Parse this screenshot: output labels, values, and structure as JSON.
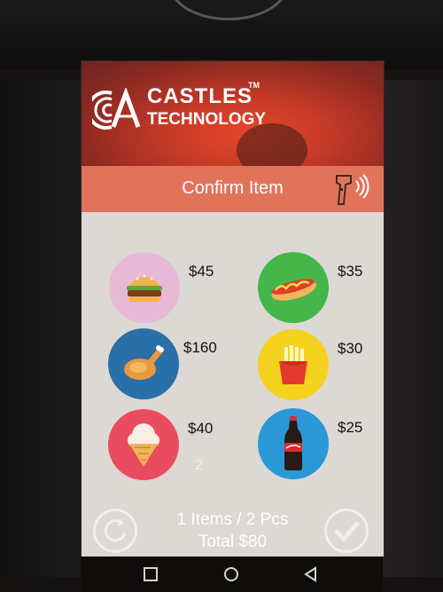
{
  "brand": {
    "name": "CASTLES",
    "tm": "TM",
    "subtitle": "TECHNOLOGY"
  },
  "title_bar": {
    "title": "Confirm Item",
    "icon": "barcode-scanner-icon"
  },
  "items": [
    {
      "name_icon": "burger-icon",
      "price": "$45",
      "qty": "",
      "color": "#e8b9d7"
    },
    {
      "name_icon": "hotdog-icon",
      "price": "$35",
      "qty": "",
      "color": "#45b649"
    },
    {
      "name_icon": "roast-chicken-icon",
      "price": "$160",
      "qty": "",
      "color": "#2a6fa8"
    },
    {
      "name_icon": "french-fries-icon",
      "price": "$30",
      "qty": "",
      "color": "#f5d21e"
    },
    {
      "name_icon": "ice-cream-icon",
      "price": "$40",
      "qty": "2",
      "color": "#e94c5f"
    },
    {
      "name_icon": "cola-bottle-icon",
      "price": "$25",
      "qty": "",
      "color": "#2a98d6"
    }
  ],
  "summary": {
    "line1": "1 Items / 2 Pcs",
    "line2": "Total $80"
  },
  "buttons": {
    "reset": "refresh-icon",
    "confirm": "checkmark-icon"
  },
  "nav": [
    "recent-apps-icon",
    "home-icon",
    "back-icon"
  ],
  "colors": {
    "title_bar": "#e2735b",
    "screen_bg": "#dcd8d3",
    "brand_red": "#c53a27"
  }
}
